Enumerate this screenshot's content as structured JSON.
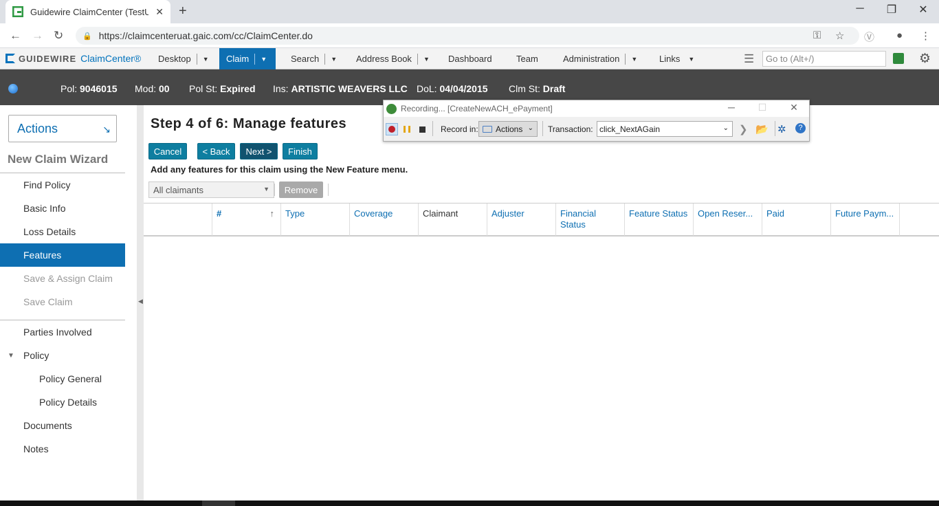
{
  "browser": {
    "tab_title": "Guidewire ClaimCenter (TestUser",
    "url": "https://claimcenteruat.gaic.com/cc/ClaimCenter.do",
    "new_tab": "+",
    "minimize": "─",
    "maximize": "❐",
    "close": "✕"
  },
  "app": {
    "logo_left": "GUIDEWIRE",
    "logo_right": "ClaimCenter®",
    "menu": [
      {
        "label": "Desktop"
      },
      {
        "label": "Claim"
      },
      {
        "label": "Search"
      },
      {
        "label": "Address Book"
      },
      {
        "label": "Dashboard"
      },
      {
        "label": "Team"
      },
      {
        "label": "Administration"
      },
      {
        "label": "Links"
      }
    ],
    "goto_placeholder": "Go to (Alt+/)"
  },
  "infobar": {
    "pol_label": "Pol:",
    "pol_value": "9046015",
    "mod_label": "Mod:",
    "mod_value": "00",
    "polst_label": "Pol St:",
    "polst_value": "Expired",
    "ins_label": "Ins:",
    "ins_value": "ARTISTIC WEAVERS LLC",
    "dol_label": "DoL:",
    "dol_value": "04/04/2015",
    "clmst_label": "Clm St:",
    "clmst_value": "Draft"
  },
  "sidebar": {
    "actions_label": "Actions",
    "wizard_title": "New Claim Wizard",
    "steps": [
      {
        "label": "Find Policy"
      },
      {
        "label": "Basic Info"
      },
      {
        "label": "Loss Details"
      },
      {
        "label": "Features"
      },
      {
        "label": "Save & Assign Claim"
      },
      {
        "label": "Save Claim"
      }
    ],
    "links": [
      {
        "label": "Parties Involved"
      },
      {
        "label": "Policy"
      },
      {
        "label": "Policy General"
      },
      {
        "label": "Policy Details"
      },
      {
        "label": "Documents"
      },
      {
        "label": "Notes"
      }
    ]
  },
  "main": {
    "title": "Step 4 of 6: Manage features",
    "buttons": {
      "cancel": "Cancel",
      "back": "< Back",
      "next": "Next >",
      "finish": "Finish"
    },
    "instructions": "Add any features for this claim using the New Feature menu.",
    "claimant_filter": "All claimants",
    "remove": "Remove",
    "columns": [
      {
        "label": "#"
      },
      {
        "label": "Type"
      },
      {
        "label": "Coverage"
      },
      {
        "label": "Claimant"
      },
      {
        "label": "Adjuster"
      },
      {
        "label": "Financial Status"
      },
      {
        "label": "Feature Status"
      },
      {
        "label": "Open Reser..."
      },
      {
        "label": "Paid"
      },
      {
        "label": "Future Paym..."
      }
    ]
  },
  "recorder": {
    "title": "Recording... [CreateNewACH_ePayment]",
    "record_in_label": "Record in:",
    "record_in_value": "Actions",
    "transaction_label": "Transaction:",
    "transaction_value": "click_NextAGain"
  }
}
